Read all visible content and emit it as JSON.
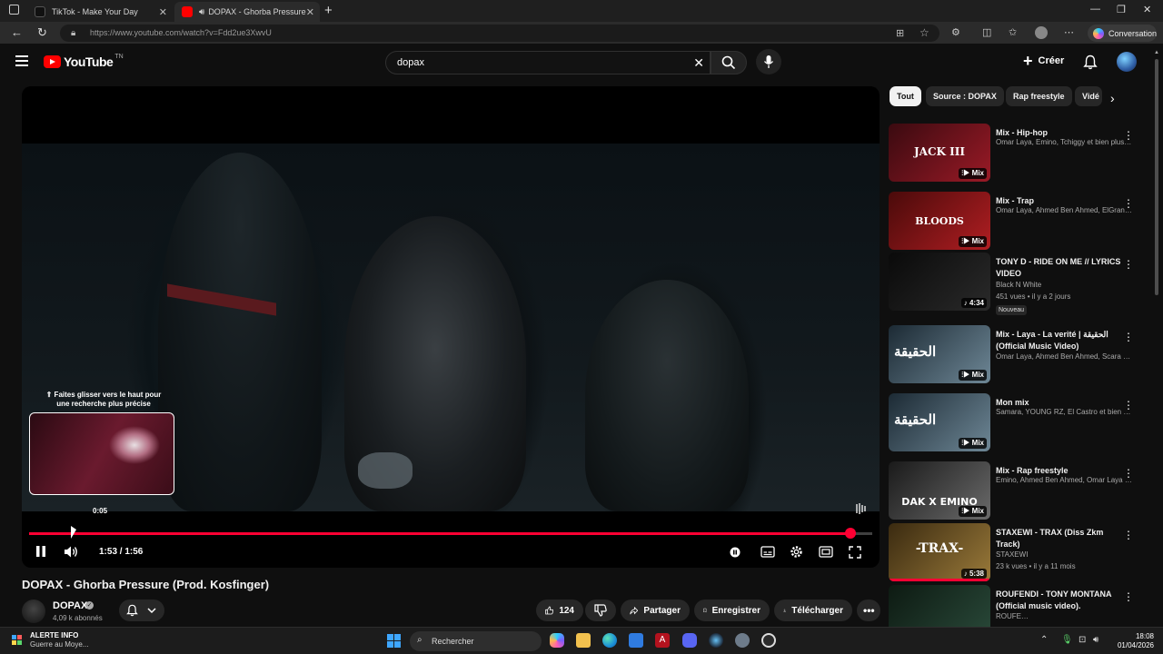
{
  "browser": {
    "tabs": [
      {
        "label": "TikTok - Make Your Day",
        "active": false
      },
      {
        "label": "DOPAX - Ghorba Pressure (P",
        "active": true
      }
    ],
    "new_tab": "+",
    "url": "https://www.youtube.com/watch?v=Fdd2ue3XwvU",
    "copilot_label": "Conversation"
  },
  "youtube": {
    "logo_text": "YouTube",
    "logo_sup": "TN",
    "search_value": "dopax",
    "create_label": "Créer"
  },
  "player": {
    "hint": "⇑ Faites glisser vers le haut pour une recherche plus précise",
    "preview_time": "0:05",
    "time_display": "1:53 / 1:56",
    "progress_fraction": 0.974,
    "scrub_preview_fraction": 0.052
  },
  "video": {
    "title": "DOPAX - Ghorba Pressure (Prod. Kosfinger)",
    "channel": "DOPAX",
    "subscribers": "4,09 k abonnés",
    "likes": "124",
    "share_label": "Partager",
    "save_label": "Enregistrer",
    "download_label": "Télécharger"
  },
  "chips": [
    "Tout",
    "Source : DOPAX",
    "Rap freestyle",
    "Vidé"
  ],
  "recommendations": [
    {
      "title": "Mix - Hip-hop",
      "sub1": "Omar Laya, Emino, Tchiggy et bien plus e...",
      "sub2": "",
      "badge": "Mix",
      "thumb_text": "JACK III",
      "colors": [
        "#3a0a10",
        "#9a1a26"
      ]
    },
    {
      "title": "Mix - Trap",
      "sub1": "Omar Laya, Ahmed Ben Ahmed, ElGrand...",
      "sub2": "",
      "badge": "Mix",
      "thumb_text": "BLOODS",
      "colors": [
        "#4a0a0a",
        "#b01e22"
      ]
    },
    {
      "title": "TONY D - RIDE ON ME // LYRICS VIDEO",
      "sub1": "Black N White",
      "sub2": "451 vues • il y a 2 jours",
      "tag": "Nouveau",
      "badge": "4:34",
      "thumb_text": "",
      "colors": [
        "#0a0a0a",
        "#2a2a2a"
      ]
    },
    {
      "title": "Mix - Laya - La verité | الحقيقة (Official Music Video)",
      "sub1": "Omar Laya, Ahmed Ben Ahmed, Scara K...",
      "sub2": "",
      "badge": "Mix",
      "thumb_text": "الحقيقة",
      "colors": [
        "#1c2a34",
        "#6e8796"
      ]
    },
    {
      "title": "Mon mix",
      "sub1": "Samara, YOUNG RZ, El Castro et bien plu...",
      "sub2": "",
      "badge": "Mix",
      "thumb_text": "الحقيقة",
      "colors": [
        "#1c2a34",
        "#6e8796"
      ]
    },
    {
      "title": "Mix - Rap freestyle",
      "sub1": "Emino, Ahmed Ben Ahmed, Omar Laya et...",
      "sub2": "",
      "badge": "Mix",
      "thumb_text": "DAK X EMINO",
      "colors": [
        "#1a1a1a",
        "#6a6a6a"
      ]
    },
    {
      "title": "STAXEWI - TRAX (Diss Zkm Track)",
      "sub1": "STAXEWI",
      "sub2": "23 k vues • il y a 11 mois",
      "badge": "5:38",
      "thumb_text": "-TRAX-",
      "colors": [
        "#3a2a10",
        "#9a7a3a"
      ]
    },
    {
      "title": "ROUFENDI - TONY MONTANA (Official music video).",
      "sub1": "ROUFENDI",
      "sub2": "",
      "badge": "",
      "thumb_text": "",
      "colors": [
        "#0d1a12",
        "#2a4a3a"
      ]
    }
  ],
  "taskbar": {
    "alert_title": "ALERTE INFO",
    "alert_sub": "Guerre au Moye...",
    "search_placeholder": "Rechercher",
    "time": "18:08",
    "date": "01/04/2026"
  },
  "colors": {
    "accent_red": "#ff0033",
    "youtube_red": "#ff0000",
    "bg": "#0f0f0f"
  }
}
